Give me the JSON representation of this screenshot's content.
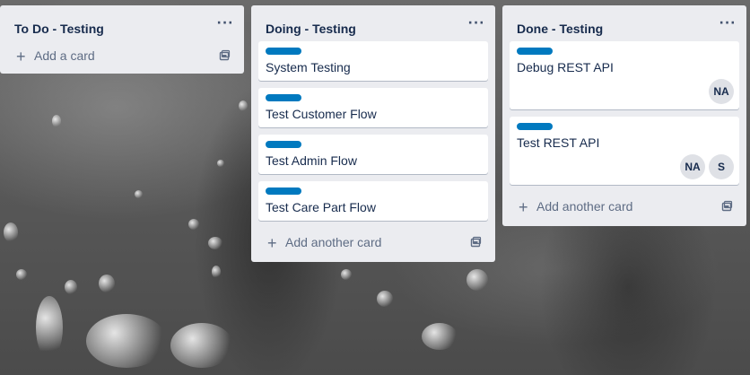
{
  "board": {
    "lists": [
      {
        "title": "To Do - Testing",
        "menu_icon": "ellipsis-icon",
        "cards": [],
        "add_card_label": "Add a card"
      },
      {
        "title": "Doing - Testing",
        "menu_icon": "ellipsis-icon",
        "cards": [
          {
            "title": "System Testing",
            "label_color": "#0079bf"
          },
          {
            "title": "Test Customer Flow",
            "label_color": "#0079bf"
          },
          {
            "title": "Test Admin Flow",
            "label_color": "#0079bf"
          },
          {
            "title": "Test Care Part Flow",
            "label_color": "#0079bf"
          }
        ],
        "add_card_label": "Add another card"
      },
      {
        "title": "Done - Testing",
        "menu_icon": "ellipsis-icon",
        "cards": [
          {
            "title": "Debug REST API",
            "label_color": "#0079bf",
            "members": [
              "NA"
            ]
          },
          {
            "title": "Test REST API",
            "label_color": "#0079bf",
            "members": [
              "NA",
              "S"
            ]
          }
        ],
        "add_card_label": "Add another card"
      }
    ]
  },
  "colors": {
    "list_bg": "#ebecf0",
    "card_bg": "#ffffff",
    "label_blue": "#0079bf",
    "text": "#172b4d",
    "muted_text": "#5e6c84",
    "avatar_bg": "#dfe1e6"
  }
}
